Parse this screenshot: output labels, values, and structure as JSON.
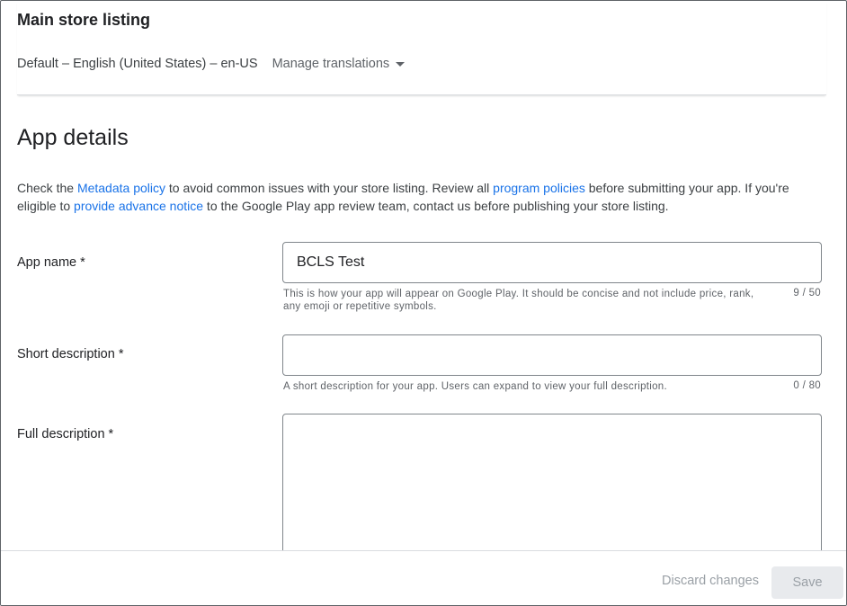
{
  "header": {
    "title": "Main store listing",
    "language": "Default – English (United States) – en-US",
    "manage_translations_label": "Manage translations"
  },
  "app_details": {
    "title": "App details",
    "intro": {
      "text_1": "Check the ",
      "link_metadata_policy": "Metadata policy",
      "text_2": " to avoid common issues with your store listing. Review all ",
      "link_program_policies": "program policies",
      "text_3": " before submitting your app. If you're eligible to ",
      "link_advance_notice": "provide advance notice",
      "text_4": " to the Google Play app review team, contact us before publishing your store listing."
    }
  },
  "fields": {
    "app_name": {
      "label": "App name  *",
      "value": "BCLS Test",
      "helper": "This is how your app will appear on Google Play. It should be concise and not include price, rank, any emoji or repetitive symbols.",
      "counter": "9 / 50"
    },
    "short_description": {
      "label": "Short description  *",
      "value": "",
      "helper": "A short description for your app. Users can expand to view your full description.",
      "counter": "0 / 80"
    },
    "full_description": {
      "label": "Full description  *",
      "value": ""
    }
  },
  "footer": {
    "discard_label": "Discard changes",
    "save_label": "Save"
  },
  "colors": {
    "link": "#1a73e8",
    "text": "#202124",
    "secondary_text": "#5f6368",
    "disabled_text": "#9aa0a6",
    "disabled_button_bg": "#e8eaed",
    "border": "#80868b",
    "divider": "#dadce0"
  },
  "icons": {
    "manage_translations_caret": "caret-down-icon"
  }
}
